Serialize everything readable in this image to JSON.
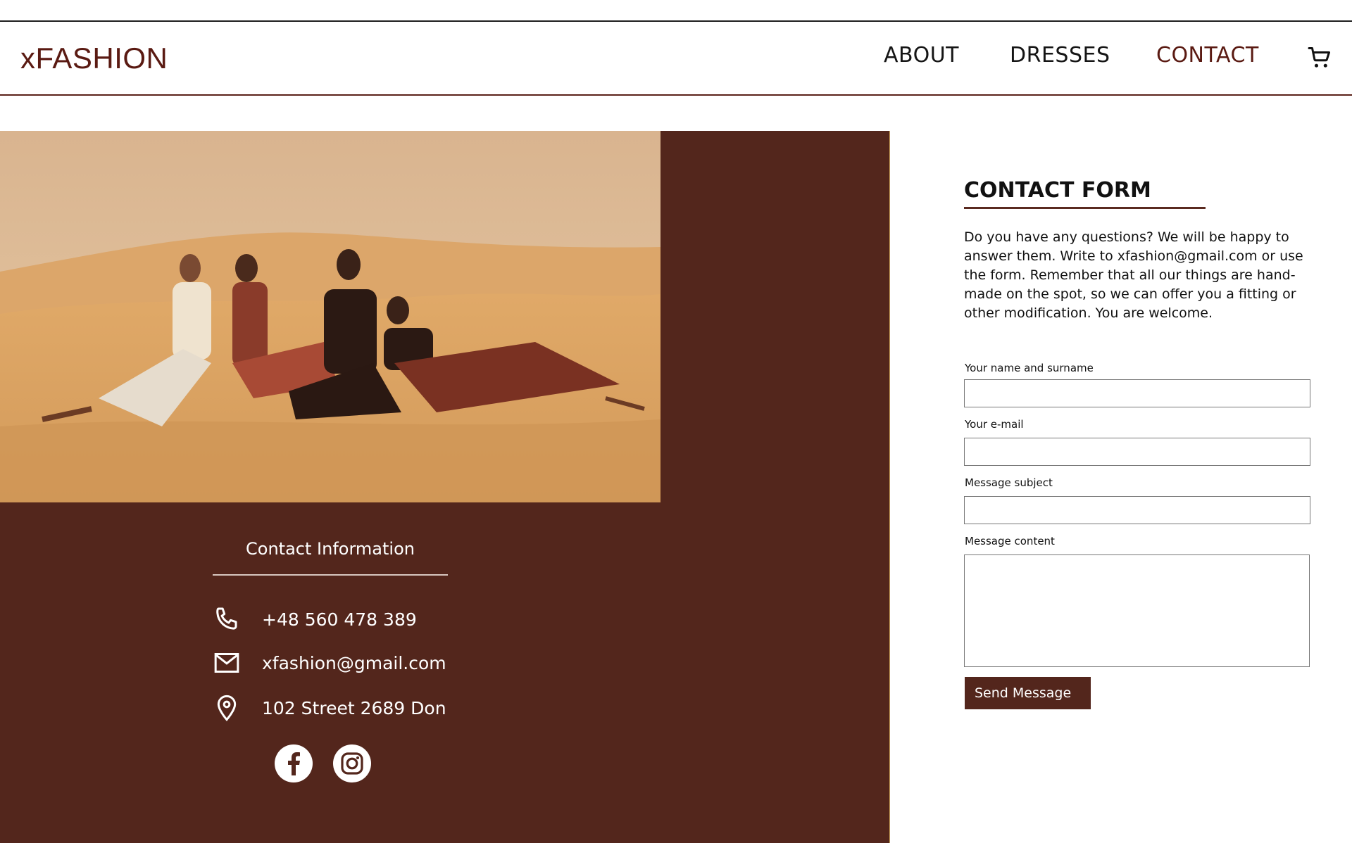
{
  "header": {
    "logo": "xFASHION",
    "nav": [
      {
        "label": "ABOUT"
      },
      {
        "label": "DRESSES"
      },
      {
        "label": "CONTACT",
        "active": true
      }
    ],
    "cart_icon": "shopping-cart-icon"
  },
  "contact_info": {
    "title": "Contact Information",
    "phone": "+48 560 478 389",
    "email": "xfashion@gmail.com",
    "address": "102 Street 2689 Don",
    "icons": [
      "phone-icon",
      "mail-icon",
      "location-pin-icon"
    ],
    "social": [
      "facebook-icon",
      "instagram-icon"
    ]
  },
  "form": {
    "title": "CONTACT FORM",
    "description": "Do you have any questions? We will be happy to answer them. Write to xfashion@gmail.com or use the form. Remember that all our things are hand-made on the spot, so we can offer you a fitting or other modification. You are welcome.",
    "fields": [
      {
        "label": "Your name and surname",
        "value": ""
      },
      {
        "label": "Your e-mail",
        "value": ""
      },
      {
        "label": "Message subject",
        "value": ""
      },
      {
        "label": "Message content",
        "value": ""
      }
    ],
    "submit_label": "Send Message"
  },
  "colors": {
    "brand": "#53261c",
    "accent_text": "#5a1a12",
    "background": "#ffffff"
  }
}
